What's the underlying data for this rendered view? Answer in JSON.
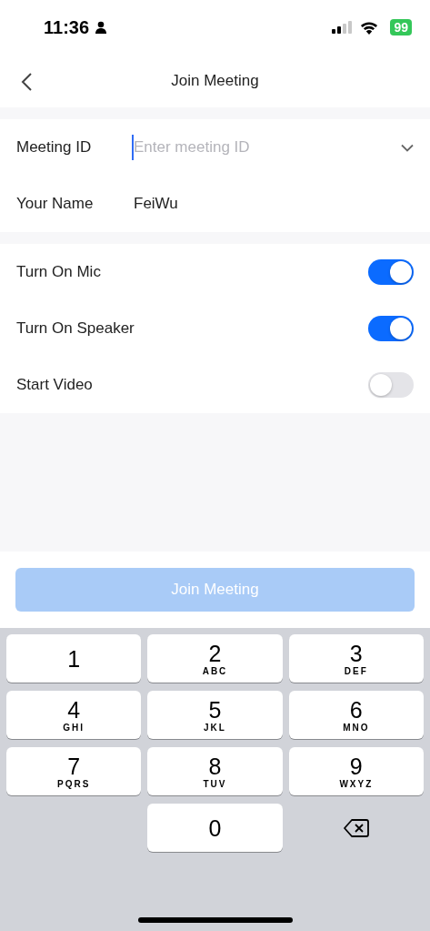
{
  "status_bar": {
    "time": "11:36",
    "battery": "99"
  },
  "nav": {
    "title": "Join Meeting"
  },
  "fields": [
    {
      "label": "Meeting ID",
      "placeholder": "Enter meeting ID",
      "focused": true,
      "dropdown": true
    },
    {
      "label": "Your Name",
      "value": "FeiWu",
      "focused": false,
      "dropdown": false
    }
  ],
  "toggles": [
    {
      "label": "Turn On Mic",
      "on": true
    },
    {
      "label": "Turn On Speaker",
      "on": true
    },
    {
      "label": "Start Video",
      "on": false
    }
  ],
  "join_button": {
    "label": "Join Meeting",
    "disabled": true
  },
  "keypad": [
    {
      "kind": "digit",
      "digit": "1"
    },
    {
      "kind": "digit",
      "digit": "2",
      "letters": "ABC"
    },
    {
      "kind": "digit",
      "digit": "3",
      "letters": "DEF"
    },
    {
      "kind": "digit",
      "digit": "4",
      "letters": "GHI"
    },
    {
      "kind": "digit",
      "digit": "5",
      "letters": "JKL"
    },
    {
      "kind": "digit",
      "digit": "6",
      "letters": "MNO"
    },
    {
      "kind": "digit",
      "digit": "7",
      "letters": "PQRS"
    },
    {
      "kind": "digit",
      "digit": "8",
      "letters": "TUV"
    },
    {
      "kind": "digit",
      "digit": "9",
      "letters": "WXYZ"
    },
    {
      "kind": "blank"
    },
    {
      "kind": "digit",
      "digit": "0"
    },
    {
      "kind": "delete"
    }
  ]
}
